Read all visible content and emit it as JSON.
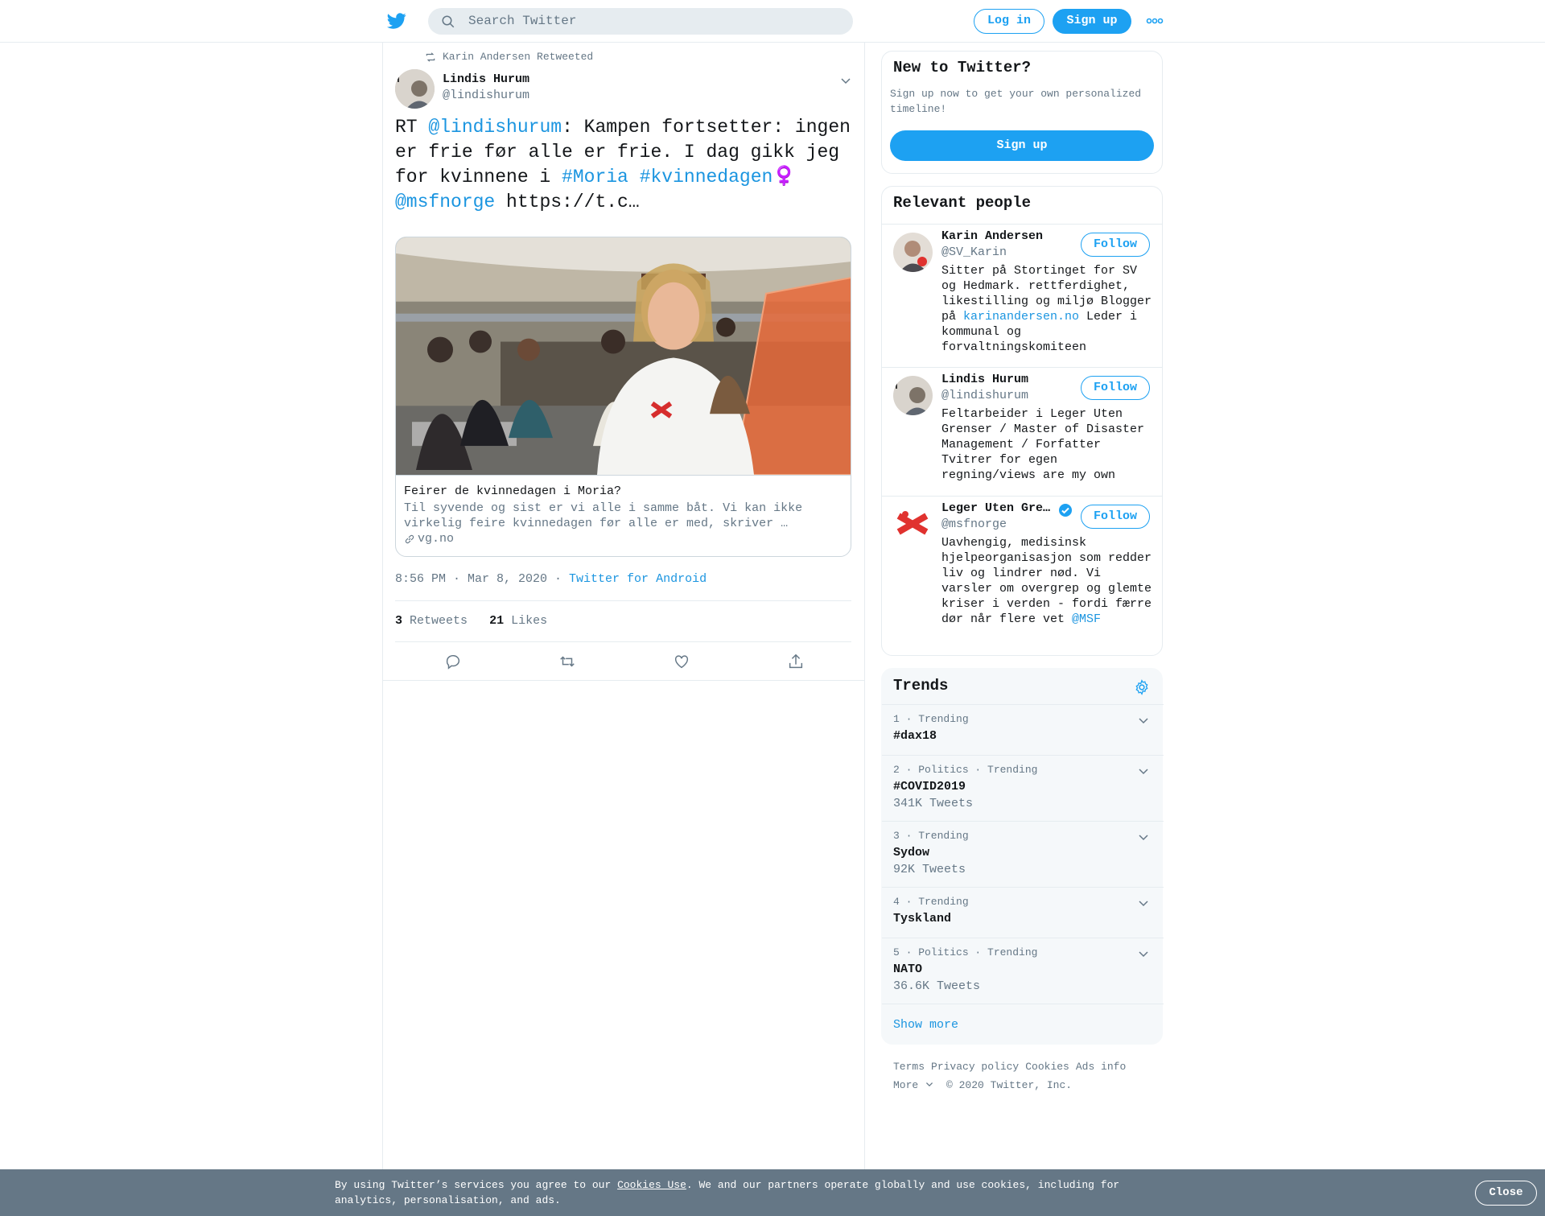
{
  "header": {
    "search_placeholder": "Search Twitter",
    "login_label": "Log in",
    "signup_label": "Sign up",
    "logo_icon": "twitter-bird-icon",
    "more_icon": "more-dots-icon",
    "brand_color": "#1da1f2"
  },
  "tweet": {
    "retweeted_by": "Karin Andersen Retweeted",
    "author_name": "Lindis Hurum",
    "author_handle": "@lindishurum",
    "text_parts": {
      "p0": "RT ",
      "p1": "@lindishurum",
      "p2": ": Kampen fortsetter: ingen er frie før alle er frie. I dag gikk jeg for kvinnene i ",
      "p3": "#Moria",
      "p4": " ",
      "p5": "#kvinnedagen",
      "p6": "♀️",
      "p7": " ",
      "p8": "@msfnorge",
      "p9": " https://t.c…"
    },
    "card": {
      "title": "Feirer de kvinnedagen i Moria?",
      "description": "Til syvende og sist er vi alle i samme båt. Vi kan ikke virkelig feire kvinnedagen før alle er med, skriver …",
      "domain": "vg.no"
    },
    "timestamp": "8:56 PM · Mar 8, 2020",
    "separator": " · ",
    "source": "Twitter for Android",
    "retweets_count": "3",
    "retweets_label": "Retweets",
    "likes_count": "21",
    "likes_label": "Likes"
  },
  "sidebar": {
    "new_to_twitter": {
      "title": "New to Twitter?",
      "subtitle": "Sign up now to get your own personalized timeline!",
      "signup_label": "Sign up"
    },
    "relevant_people": {
      "title": "Relevant people",
      "people": [
        {
          "name": "Karin Andersen",
          "handle": "@SV_Karin",
          "follow_label": "Follow",
          "bio_before": "Sitter på Stortinget for SV og Hedmark. rettferdighet, likestilling og miljø Blogger på ",
          "bio_link": "karinandersen.no",
          "bio_after": " Leder i kommunal og forvaltningskomiteen"
        },
        {
          "name": "Lindis Hurum",
          "handle": "@lindishurum",
          "follow_label": "Follow",
          "bio": "Feltarbeider i Leger Uten Grenser / Master of Disaster Management / Forfatter Tvitrer for egen regning/views are my own"
        },
        {
          "name": "Leger Uten Gre…",
          "handle": "@msfnorge",
          "follow_label": "Follow",
          "bio_before": "Uavhengig, medisinsk hjelpeorganisasjon som redder liv og lindrer nød. Vi varsler om overgrep og glemte kriser i verden - fordi færre dør når flere vet ",
          "bio_link": "@MSF",
          "verified": true
        }
      ]
    },
    "trends": {
      "title": "Trends",
      "items": [
        {
          "meta": "1 · Trending",
          "name": "#dax18",
          "count": ""
        },
        {
          "meta": "2 · Politics · Trending",
          "name": "#COVID2019",
          "count": "341K Tweets"
        },
        {
          "meta": "3 · Trending",
          "name": "Sydow",
          "count": "92K Tweets"
        },
        {
          "meta": "4 · Trending",
          "name": "Tyskland",
          "count": ""
        },
        {
          "meta": "5 · Politics · Trending",
          "name": "NATO",
          "count": "36.6K Tweets"
        }
      ],
      "show_more": "Show more"
    },
    "footer": {
      "links": [
        "Terms",
        "Privacy policy",
        "Cookies",
        "Ads info"
      ],
      "more_label": "More",
      "copyright": "© 2020 Twitter, Inc."
    }
  },
  "cookie_bar": {
    "text_before": "By using Twitter’s services you agree to our ",
    "link": "Cookies Use",
    "text_after": ". We and our partners operate globally and use cookies, including for analytics, personalisation, and ads.",
    "close_label": "Close"
  }
}
